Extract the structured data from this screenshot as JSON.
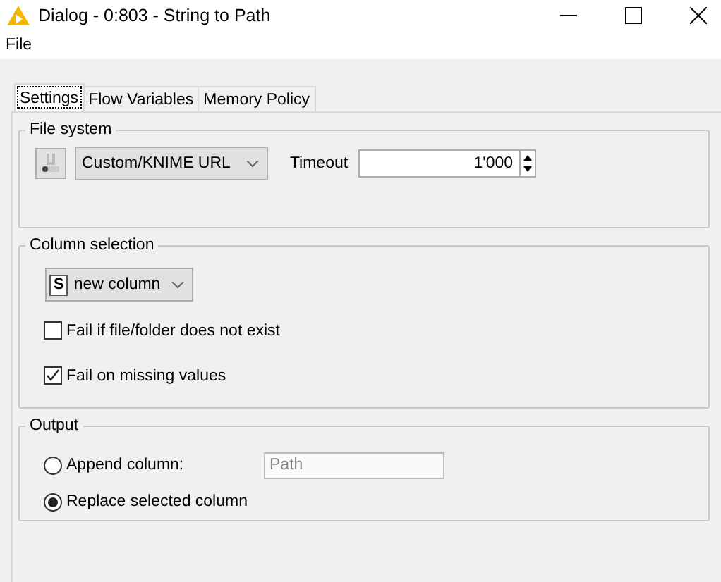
{
  "window": {
    "title": "Dialog - 0:803 - String to Path"
  },
  "menu": [
    "File"
  ],
  "tabs": [
    {
      "label": "Settings",
      "selected": true
    },
    {
      "label": "Flow Variables",
      "selected": false
    },
    {
      "label": "Memory Policy",
      "selected": false
    }
  ],
  "file_system": {
    "title": "File system",
    "dropdown": "Custom/KNIME URL",
    "timeout_label": "Timeout",
    "timeout": "1'000"
  },
  "column_selection": {
    "title": "Column selection",
    "column_type": "S",
    "column": "new column",
    "options": [
      {
        "label": "Fail if file/folder does not exist",
        "checked": false
      },
      {
        "label": "Fail on missing values",
        "checked": true
      }
    ]
  },
  "output": {
    "title": "Output",
    "options": [
      {
        "label": "Append column:",
        "selected": false,
        "field": {
          "value": "Path",
          "disabled": true
        }
      },
      {
        "label": "Replace selected column",
        "selected": true
      }
    ]
  }
}
